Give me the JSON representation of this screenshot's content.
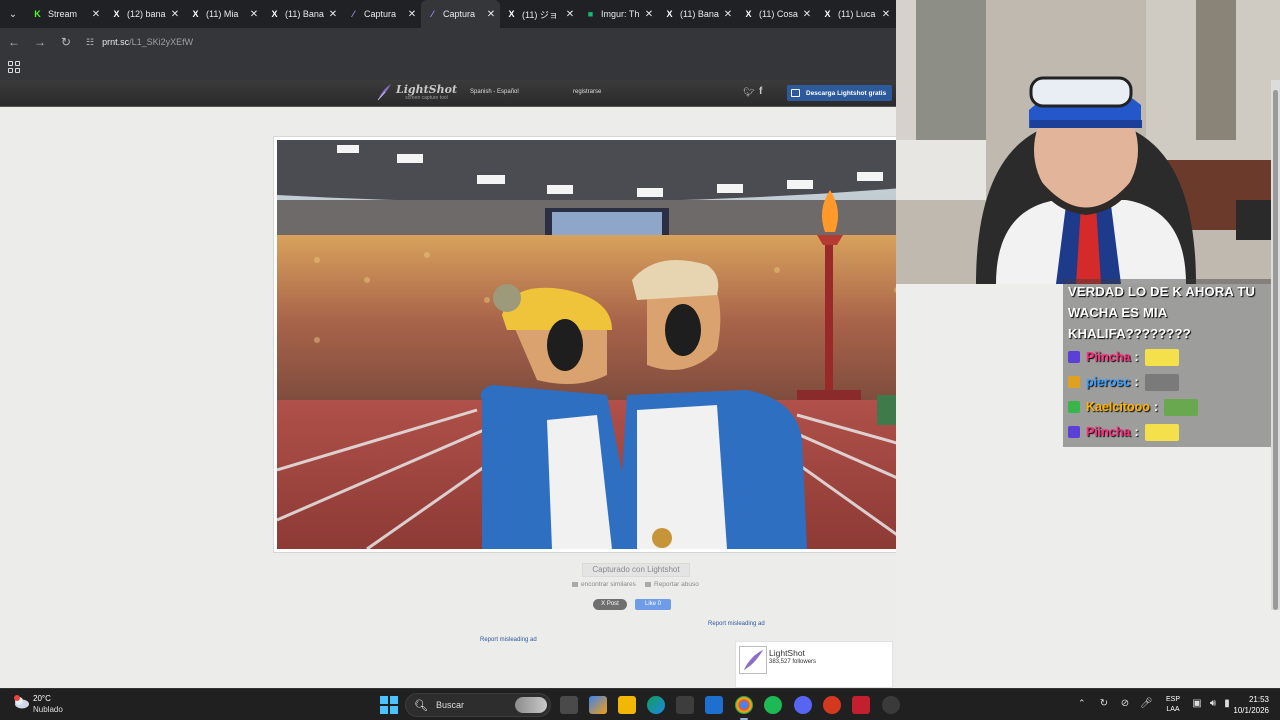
{
  "browser": {
    "tabs": [
      {
        "title": "Stream",
        "icon": "kick-icon",
        "active": false
      },
      {
        "title": "(12) bana",
        "icon": "x-icon",
        "active": false
      },
      {
        "title": "(11) Mia",
        "icon": "x-icon",
        "active": false
      },
      {
        "title": "(11) Bana",
        "icon": "x-icon",
        "active": false
      },
      {
        "title": "Captura",
        "icon": "lightshot-icon",
        "active": false
      },
      {
        "title": "Captura",
        "icon": "lightshot-icon",
        "active": true
      },
      {
        "title": "(11) ジョ",
        "icon": "x-icon",
        "active": false
      },
      {
        "title": "Imgur: Th",
        "icon": "imgur-icon",
        "active": false
      },
      {
        "title": "(11) Bana",
        "icon": "x-icon",
        "active": false
      },
      {
        "title": "(11) Cosa",
        "icon": "x-icon",
        "active": false
      },
      {
        "title": "(11) Luca",
        "icon": "x-icon",
        "active": false
      }
    ],
    "url_host": "prnt.sc",
    "url_path": "/L1_SKi2yXEfW"
  },
  "lightshot": {
    "logo_name": "LightShot",
    "logo_tagline": "screen capture tool",
    "language": "Spanish - Español",
    "register": "registrarse",
    "download_button": "Descarga Lightshot gratis",
    "caption": "Capturado con Lightshot",
    "find_similar": "encontrar similares",
    "report_abuse": "Reportar abuso",
    "x_post": "X Post",
    "fb_like": "Like 0",
    "report_ad": "Report misleading ad",
    "ad_card": {
      "name": "LightShot",
      "followers": "383,527 followers"
    }
  },
  "chat": {
    "message": "VERDAD LO DE K AHORA TU WACHA ES MIA KHALIFA????????",
    "rows": [
      {
        "user": "Piincha",
        "color": "#ff2e7e",
        "badge": "#5b3fd6",
        "emote": "#f4e04a"
      },
      {
        "user": "pierosc",
        "color": "#3aa0ff",
        "badge": "#e0a020",
        "emote": "#7a7a7a"
      },
      {
        "user": "Kaelcitooo",
        "color": "#ffb400",
        "badge": "#39b54a",
        "emote": "#6aa84f"
      },
      {
        "user": "Piincha",
        "color": "#ff2e7e",
        "badge": "#5b3fd6",
        "emote": "#f4e04a"
      }
    ]
  },
  "taskbar": {
    "weather_temp": "20°C",
    "weather_condition": "Nublado",
    "search_placeholder": "Buscar",
    "lang_line1": "ESP",
    "lang_line2": "LAA",
    "time": "21:53",
    "date": "10/1/2026"
  }
}
